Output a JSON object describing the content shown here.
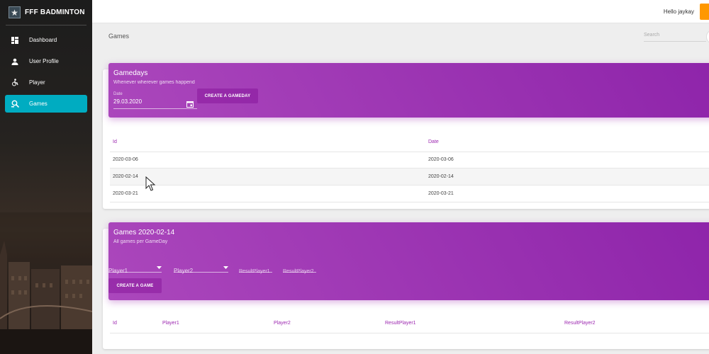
{
  "app": {
    "title": "FFF BADMINTON"
  },
  "sidebar": {
    "items": [
      {
        "label": "Dashboard",
        "icon": "dashboard-icon",
        "active": false
      },
      {
        "label": "User Profile",
        "icon": "person-icon",
        "active": false
      },
      {
        "label": "Player",
        "icon": "accessible-icon",
        "active": false
      },
      {
        "label": "Games",
        "icon": "search-icon",
        "active": true
      }
    ]
  },
  "topbar": {
    "greeting": "Hello jaykay",
    "accent_color": "#ff9800"
  },
  "page": {
    "title": "Games"
  },
  "search": {
    "placeholder": "Search"
  },
  "gamedays": {
    "title": "Gamedays",
    "subtitle": "Whenever wherever games happend",
    "date_label": "Date",
    "date_value": "29.03.2020",
    "create_label": "CREATE A GAMEDAY",
    "columns": [
      "Id",
      "Date"
    ],
    "rows": [
      [
        "2020-03-06",
        "2020-03-06"
      ],
      [
        "2020-02-14",
        "2020-02-14"
      ],
      [
        "2020-03-21",
        "2020-03-21"
      ]
    ]
  },
  "games": {
    "title": "Games 2020-02-14",
    "subtitle": "All games per GameDay",
    "player1_placeholder": "Player1",
    "player2_placeholder": "Player2",
    "result1_placeholder": "ResultPlayer1",
    "result2_placeholder": "ResultPlayer2",
    "create_label": "CREATE A GAME",
    "columns": [
      "Id",
      "Player1",
      "Player2",
      "ResultPlayer1",
      "ResultPlayer2"
    ]
  },
  "colors": {
    "active_nav": "#00acc1",
    "card_header": "#9c27b0",
    "sidebar_bg": "#1c1c1c"
  }
}
